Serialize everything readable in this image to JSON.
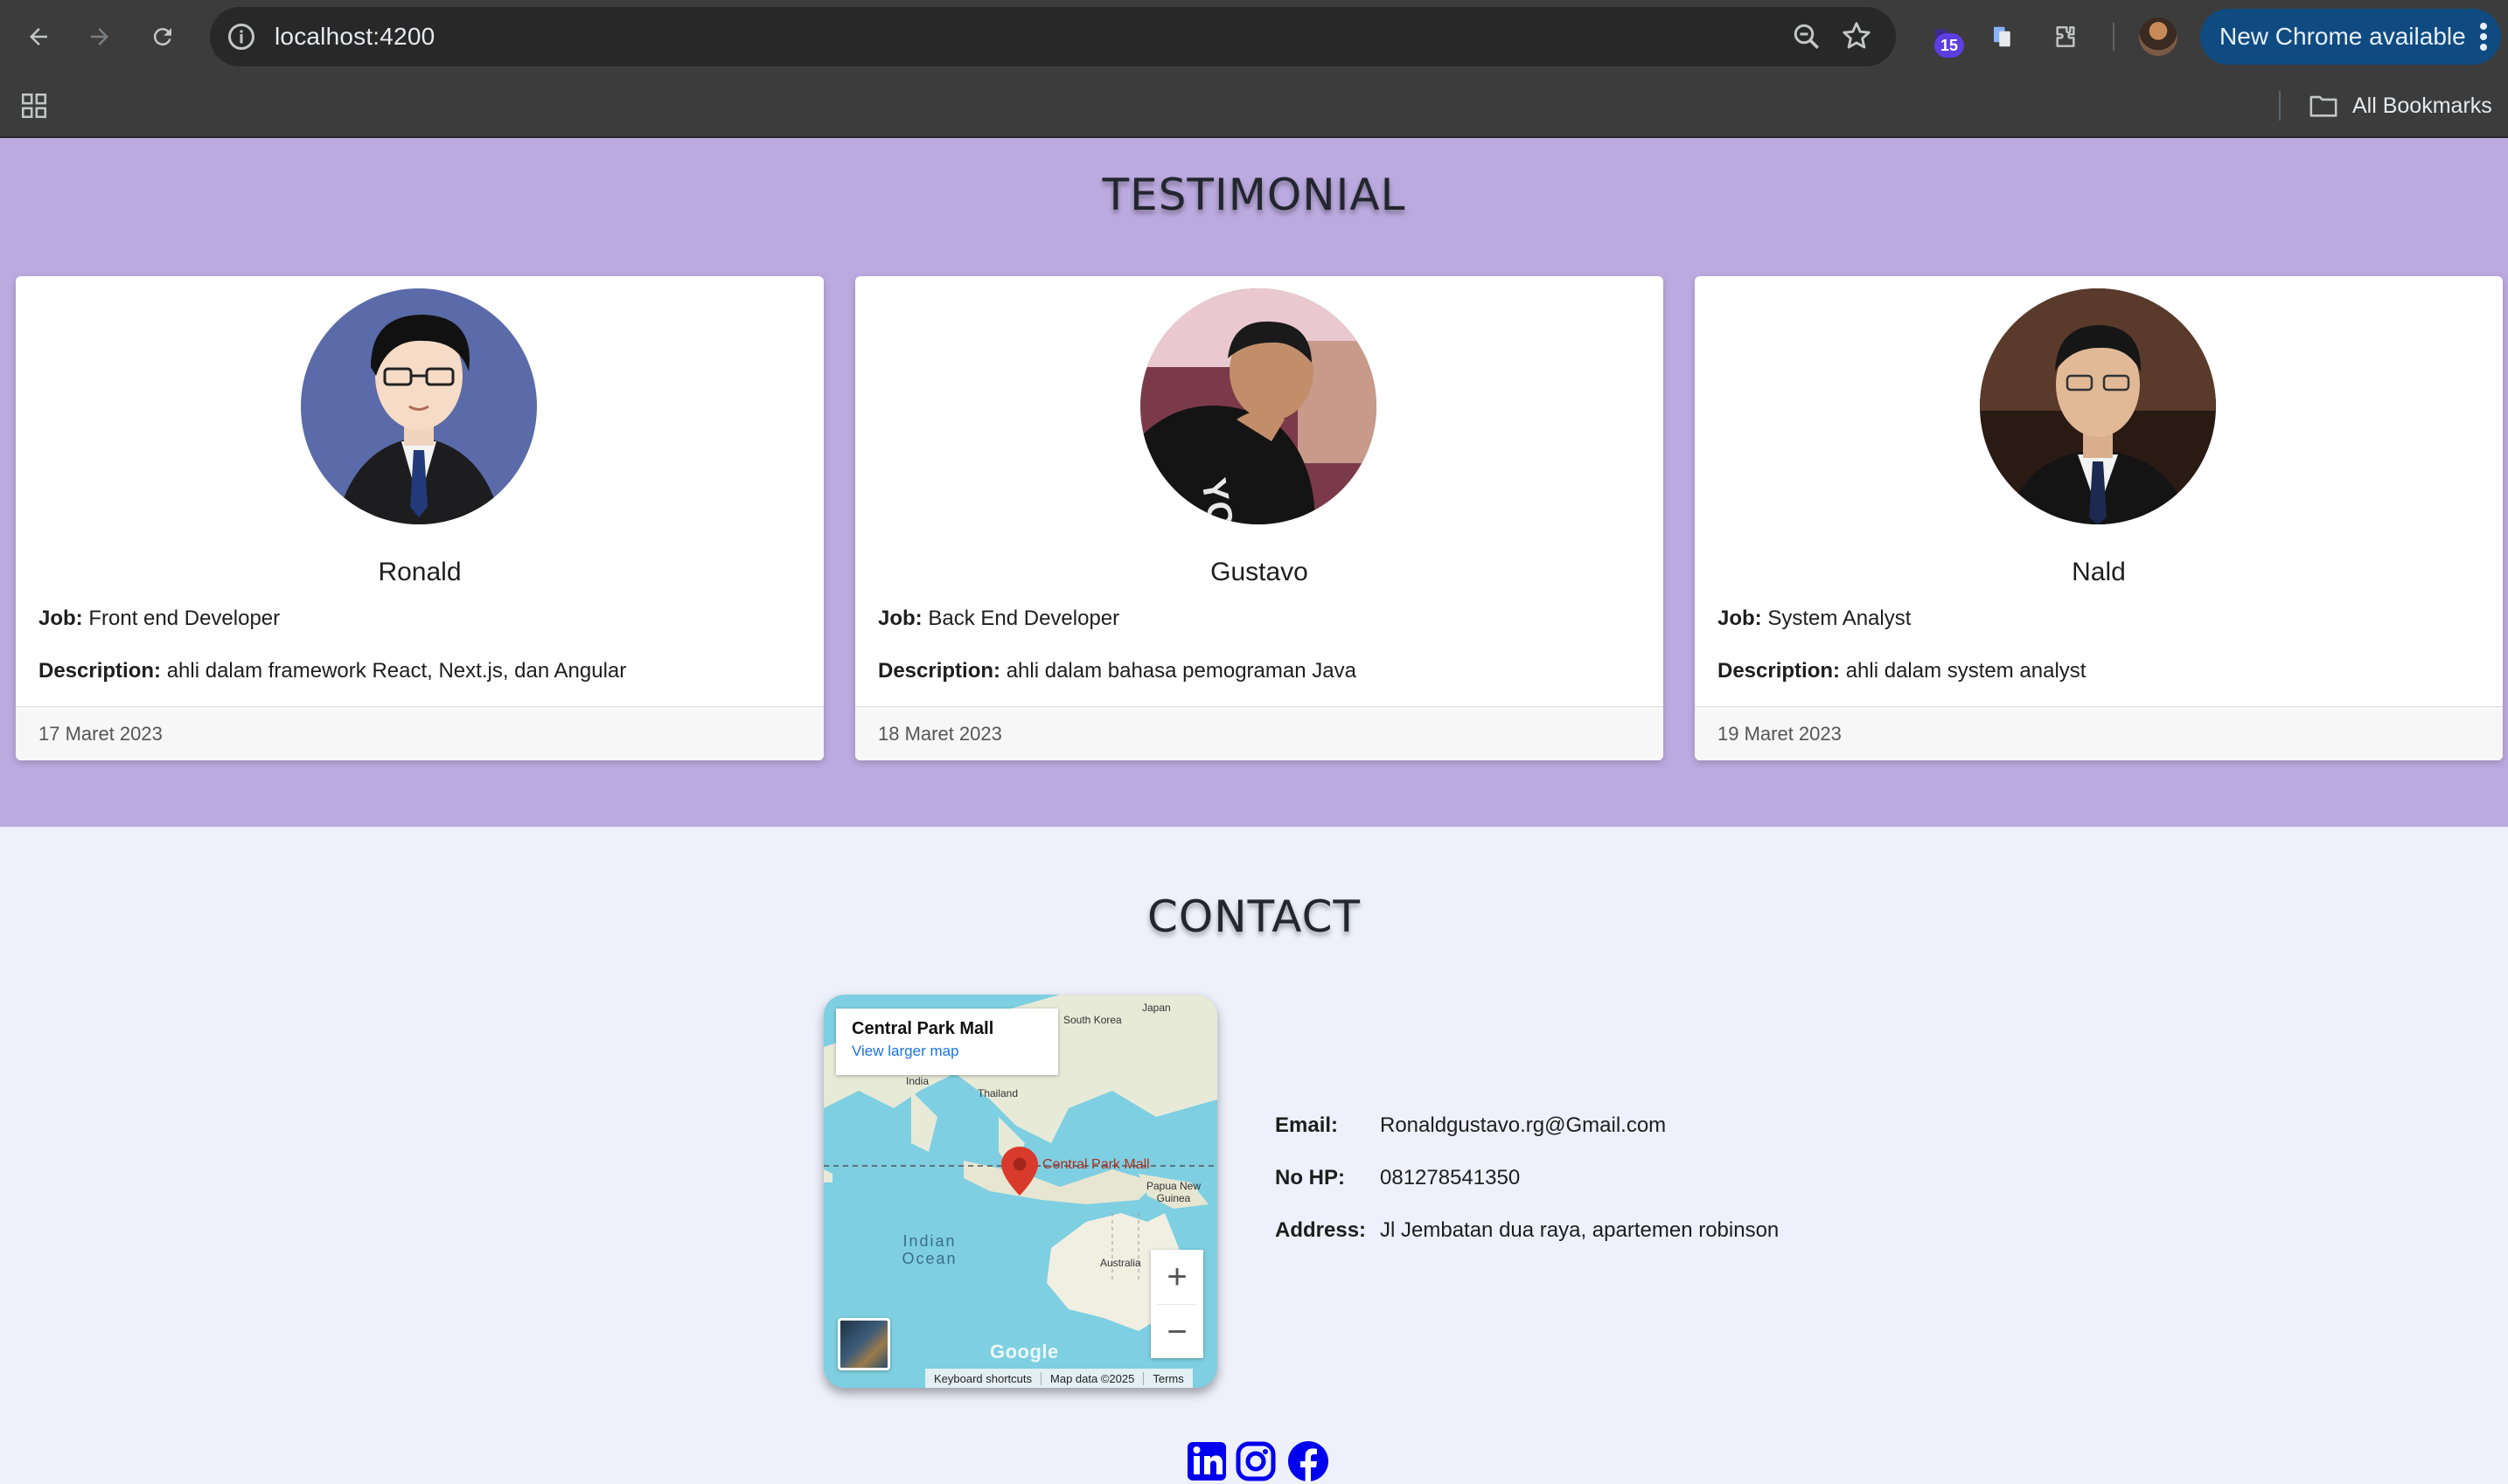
{
  "browser": {
    "url": "localhost:4200",
    "extension_badge": "15",
    "update_label": "New Chrome available",
    "all_bookmarks": "All Bookmarks"
  },
  "testimonial": {
    "title": "TESTIMONIAL",
    "job_label": "Job:",
    "description_label": "Description:",
    "cards": [
      {
        "name": "Ronald",
        "job": "Front end Developer",
        "description": "ahli dalam framework React, Next.js, dan Angular",
        "date": "17 Maret 2023"
      },
      {
        "name": "Gustavo",
        "job": "Back End Developer",
        "description": "ahli dalam bahasa pemograman Java",
        "date": "18 Maret 2023"
      },
      {
        "name": "Nald",
        "job": "System Analyst",
        "description": "ahli dalam system analyst",
        "date": "19 Maret 2023"
      }
    ]
  },
  "contact": {
    "title": "CONTACT",
    "map": {
      "place": "Central Park Mall",
      "link": "View larger map",
      "labels": {
        "japan": "Japan",
        "south_korea": "South Korea",
        "india": "India",
        "thailand": "Thailand",
        "papua": "Papua New Guinea",
        "australia": "Australia",
        "marker": "Central Park Mall",
        "ocean": "Indian Ocean"
      },
      "zoom_in": "+",
      "zoom_out": "−",
      "google": "Google",
      "keyboard": "Keyboard shortcuts",
      "map_data": "Map data ©2025",
      "terms": "Terms"
    },
    "email_label": "Email:",
    "email": "Ronaldgustavo.rg@Gmail.com",
    "phone_label": "No HP:",
    "phone": "081278541350",
    "address_label": "Address:",
    "address": "Jl Jembatan dua raya, apartemen robinson"
  },
  "social": {
    "icons": [
      "linkedin-icon",
      "instagram-icon",
      "facebook-icon"
    ],
    "color": "#0000ee"
  },
  "colors": {
    "testimonial_bg": "#bbaadf",
    "contact_bg": "#eef0fb",
    "update_button": "#0f4b80"
  }
}
